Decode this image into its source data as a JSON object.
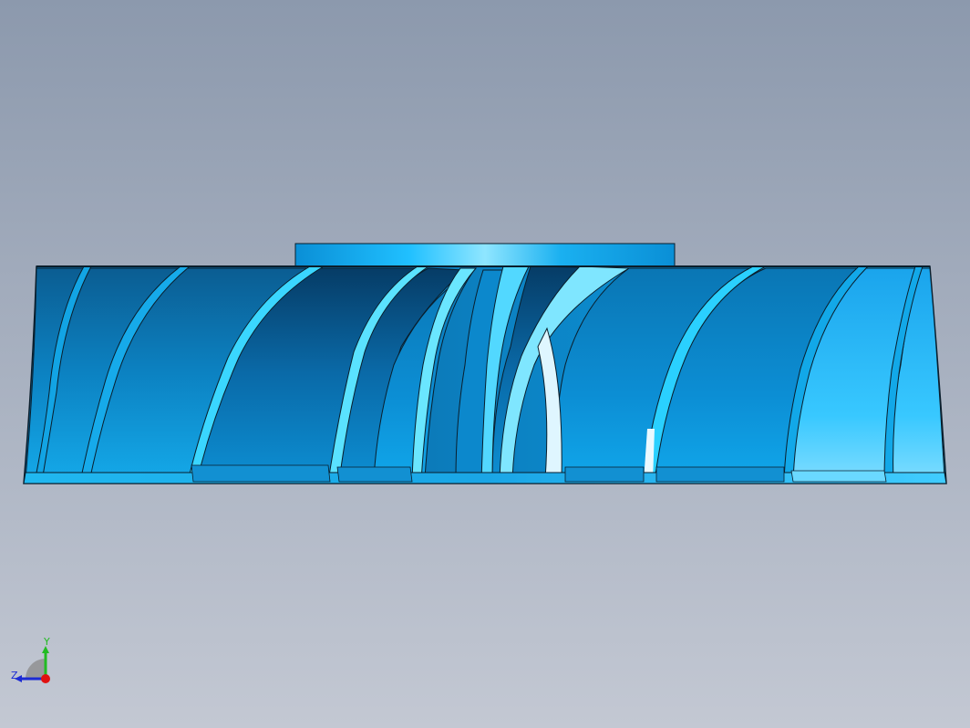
{
  "viewport": {
    "background_top": "#8c99ad",
    "background_bottom": "#c3c8d3"
  },
  "model": {
    "name": "impeller",
    "edge_color": "#0a1e2c",
    "face_dark": "#04507e",
    "face_mid": "#0a86c8",
    "face_light": "#1ab8f0",
    "highlight": "#dff6ff"
  },
  "triad": {
    "y_label": "Y",
    "z_label": "Z",
    "y_color": "#22bb22",
    "z_color": "#1b2ad4",
    "x_color": "#e01010"
  }
}
